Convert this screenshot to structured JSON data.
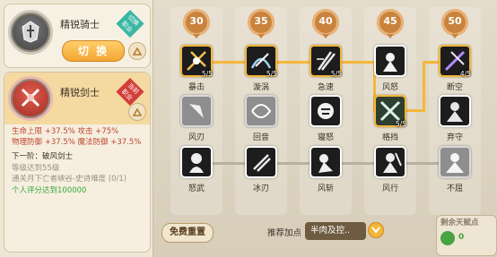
{
  "classes": [
    {
      "name": "精锐骑士",
      "ribbon": "切换职业",
      "button": "切 换"
    },
    {
      "name": "精锐剑士",
      "ribbon": "当前职业"
    }
  ],
  "stats": {
    "line1": "生命上限 +37.5% 攻击 +75%",
    "line2": "物理防御 +37.5% 魔法防御 +37.5%"
  },
  "next": {
    "title": "下一阶：破风剑士",
    "req1": "等级达到55级",
    "req2": "通关月下亡者峡谷-史诗难度 (0/1)",
    "req3": "个人评分达到100000"
  },
  "tiers": [
    "30",
    "35",
    "40",
    "45",
    "50"
  ],
  "skills_row1": [
    {
      "name": "暴击",
      "level": "5/5"
    },
    {
      "name": "漩涡",
      "level": "5/5"
    },
    {
      "name": "急速",
      "level": "5/5"
    },
    {
      "name": "风怒",
      "level": ""
    },
    {
      "name": "断空",
      "level": "4/5"
    }
  ],
  "skills_row2": [
    {
      "name": "风刃",
      "level": ""
    },
    {
      "name": "回音",
      "level": ""
    },
    {
      "name": "寝怒",
      "level": ""
    },
    {
      "name": "格挡",
      "level": "5/5"
    },
    {
      "name": "弃守",
      "level": ""
    }
  ],
  "skills_row3": [
    {
      "name": "怒武",
      "level": ""
    },
    {
      "name": "冰刃",
      "level": ""
    },
    {
      "name": "风斩",
      "level": ""
    },
    {
      "name": "风行",
      "level": ""
    },
    {
      "name": "不屈",
      "level": ""
    }
  ],
  "bottom": {
    "reset": "免费重置",
    "recommend_label": "推荐加点",
    "recommend_value": "半肉及控..",
    "remain_label": "剩余天赋点",
    "remain_value": "0"
  },
  "colors": {
    "accent": "#f5b73a",
    "tier": "#c9833d",
    "active_border": "#f5b73a"
  }
}
